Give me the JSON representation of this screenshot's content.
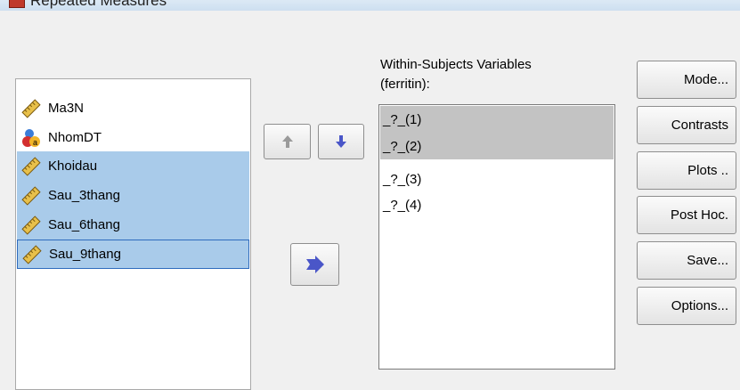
{
  "window": {
    "title": "Repeated Measures"
  },
  "source_variables": [
    {
      "label": "Ma3N",
      "icon": "scale-ruler-icon",
      "selected": false
    },
    {
      "label": "NhomDT",
      "icon": "nominal-icon",
      "selected": false
    },
    {
      "label": "Khoidau",
      "icon": "scale-ruler-icon",
      "selected": true
    },
    {
      "label": "Sau_3thang",
      "icon": "scale-ruler-icon",
      "selected": true
    },
    {
      "label": "Sau_6thang",
      "icon": "scale-ruler-icon",
      "selected": true
    },
    {
      "label": "Sau_9thang",
      "icon": "scale-ruler-icon",
      "selected": true
    }
  ],
  "within_subjects": {
    "label_line1": "Within-Subjects Variables",
    "label_line2": "(ferritin):",
    "items": [
      "_?_(1)",
      "_?_(2)",
      "_?_(3)",
      "_?_(4)"
    ]
  },
  "side_buttons": {
    "model": "Mode...",
    "contrasts": "Contrasts",
    "plots": "Plots ..",
    "post_hoc": "Post Hoc.",
    "save": "Save...",
    "options": "Options..."
  },
  "colors": {
    "selection": "#a9cbea",
    "arrow": "#4a56c8",
    "list_selection": "#c3c3c3"
  }
}
